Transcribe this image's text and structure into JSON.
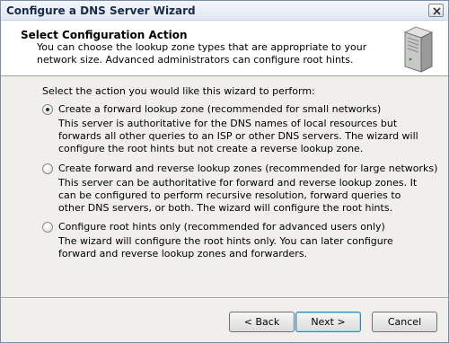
{
  "window": {
    "title": "Configure a DNS Server Wizard",
    "close_symbol": "×"
  },
  "header": {
    "title": "Select Configuration Action",
    "description": "You can choose the lookup zone types that are appropriate to your network size. Advanced administrators can configure root hints.",
    "icon": "server-icon"
  },
  "main": {
    "prompt": "Select the action you would like this wizard to perform:",
    "options": [
      {
        "label": "Create a forward lookup zone (recommended for small networks)",
        "description": "This server is authoritative for the DNS names of local resources but forwards all other queries to an ISP or other DNS servers. The wizard will configure the root hints but not create a reverse lookup zone.",
        "selected": true
      },
      {
        "label": "Create forward and reverse lookup zones (recommended for large networks)",
        "description": "This server can be authoritative for forward and reverse lookup zones. It can be configured to perform recursive resolution, forward queries to other DNS servers, or both. The wizard will configure the root hints.",
        "selected": false
      },
      {
        "label": "Configure root hints only (recommended for advanced users only)",
        "description": "The wizard will configure the root hints only. You can later configure forward and reverse lookup zones and forwarders.",
        "selected": false
      }
    ]
  },
  "footer": {
    "back_label": "< Back",
    "next_label": "Next >",
    "cancel_label": "Cancel"
  }
}
